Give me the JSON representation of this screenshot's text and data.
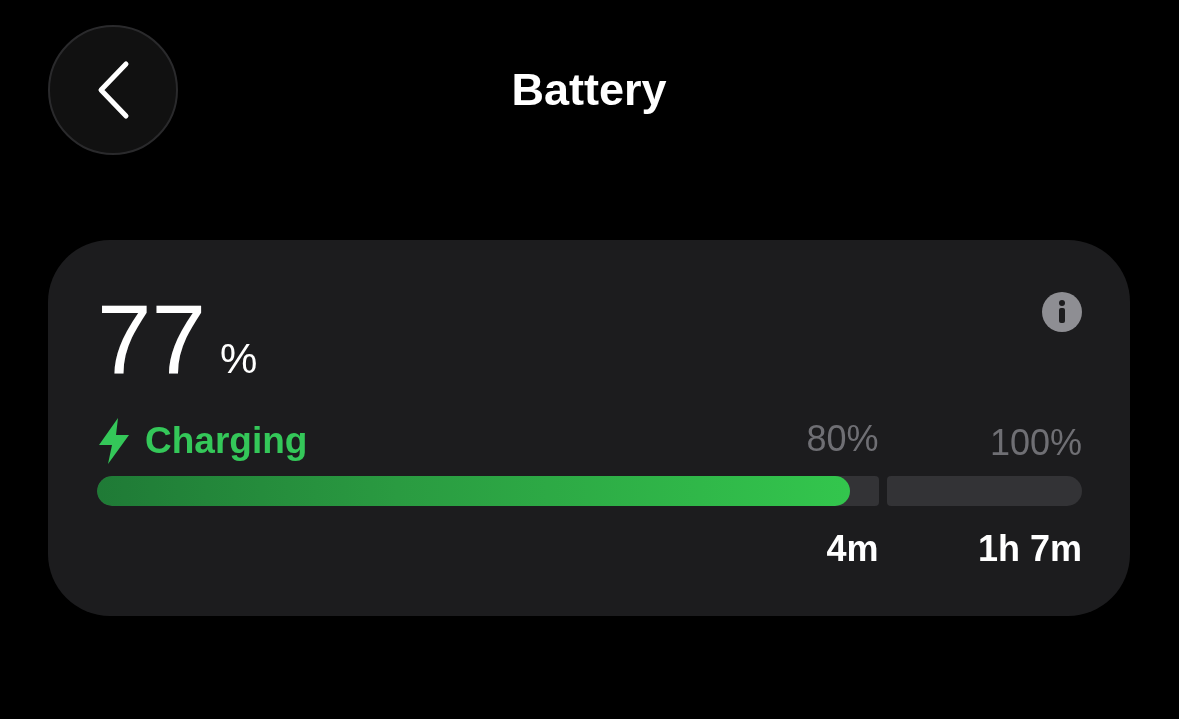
{
  "header": {
    "title": "Battery"
  },
  "battery": {
    "percent": "77",
    "unit": "%",
    "charging": true,
    "status": "Charging",
    "segments": [
      {
        "label": "80%",
        "time": "4m",
        "level": 0.963
      },
      {
        "label": "100%",
        "time": "1h 7m"
      }
    ]
  }
}
